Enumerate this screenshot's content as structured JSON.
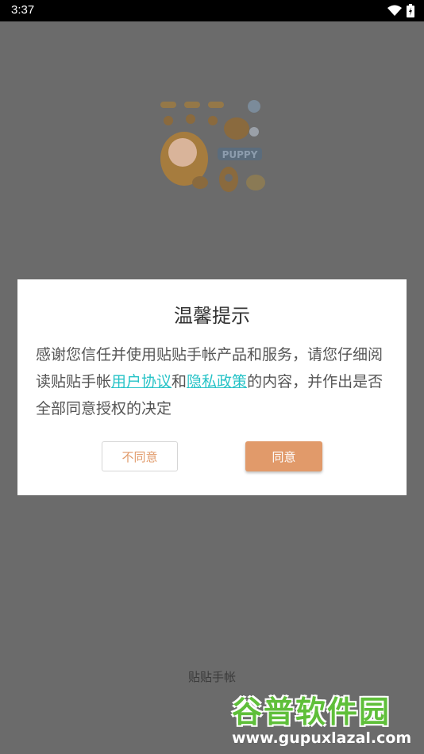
{
  "status_bar": {
    "time": "3:37"
  },
  "dialog": {
    "title": "温馨提示",
    "body_prefix": "感谢您信任并使用贴贴手帐产品和服务，请您仔细阅读贴贴手帐",
    "link_user_agreement": "用户协议",
    "body_and": "和",
    "link_privacy_policy": "隐私政策",
    "body_suffix": "的内容，并作出是否全部同意授权的决定",
    "disagree_label": "不同意",
    "agree_label": "同意"
  },
  "splash": {
    "art_label": "PUPPY"
  },
  "footer": {
    "app_name": "贴贴手帐",
    "watermark_top": "谷普软件园",
    "watermark_bottom": "www.gupuxlazal.com"
  },
  "colors": {
    "accent": "#e19a6a",
    "link": "#27c3c7",
    "overlay": "#6b6b6b"
  }
}
